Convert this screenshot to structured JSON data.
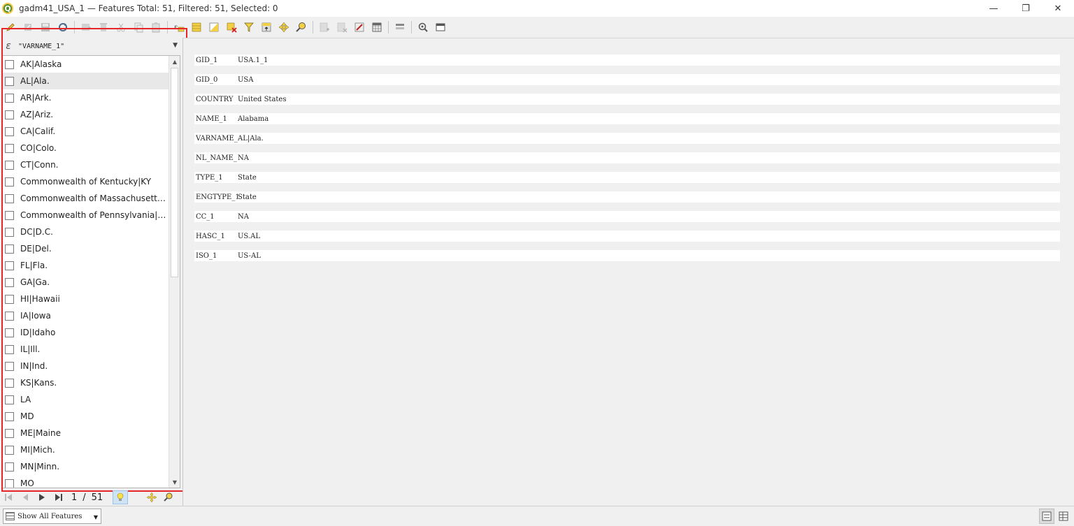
{
  "window": {
    "title": "gadm41_USA_1 — Features Total: 51, Filtered: 51, Selected: 0",
    "minimize": "—",
    "restore": "❐",
    "close": "✕"
  },
  "toolbar": {
    "icons": [
      "pencil-icon",
      "save-edits-icon",
      "save-icon",
      "reload-icon",
      "add-feature-icon",
      "delete-feature-icon",
      "cut-icon",
      "copy-icon",
      "paste-icon",
      "expression-select-icon",
      "select-all-icon",
      "invert-selection-icon",
      "deselect-icon",
      "filter-icon",
      "move-selection-to-top-icon",
      "pan-to-selected-icon",
      "zoom-to-selected-icon",
      "new-field-icon",
      "delete-field-icon",
      "edit-field-icon",
      "field-calculator-icon",
      "conditional-formatting-icon",
      "actions-icon",
      "dock-icon"
    ]
  },
  "left": {
    "expression": "\"VARNAME_1\"",
    "expression_icon": "ε",
    "items": [
      "AK|Alaska",
      "AL|Ala.",
      "AR|Ark.",
      "AZ|Ariz.",
      "CA|Calif.",
      "CO|Colo.",
      "CT|Conn.",
      "Commonwealth of Kentucky|KY",
      "Commonwealth of Massachusetts|...",
      "Commonwealth of Pennsylvania|PA",
      "DC|D.C.",
      "DE|Del.",
      "FL|Fla.",
      "GA|Ga.",
      "HI|Hawaii",
      "IA|Iowa",
      "ID|Idaho",
      "IL|Ill.",
      "IN|Ind.",
      "KS|Kans.",
      "LA",
      "MD",
      "ME|Maine",
      "MI|Mich.",
      "MN|Minn.",
      "MO"
    ],
    "selected_index": 1
  },
  "nav": {
    "current": "1",
    "separator": "/",
    "total": "51"
  },
  "attributes": [
    {
      "name": "GID_1",
      "value": "USA.1_1"
    },
    {
      "name": "GID_0",
      "value": "USA"
    },
    {
      "name": "COUNTRY",
      "value": "United States"
    },
    {
      "name": "NAME_1",
      "value": "Alabama"
    },
    {
      "name": "VARNAME_1",
      "value": "AL|Ala."
    },
    {
      "name": "NL_NAME_1",
      "value": "NA"
    },
    {
      "name": "TYPE_1",
      "value": "State"
    },
    {
      "name": "ENGTYPE_1",
      "value": "State"
    },
    {
      "name": "CC_1",
      "value": "NA"
    },
    {
      "name": "HASC_1",
      "value": "US.AL"
    },
    {
      "name": "ISO_1",
      "value": "US-AL"
    }
  ],
  "bottom": {
    "show_all_label": "Show All Features"
  },
  "colors": {
    "highlight": "#e8262a"
  }
}
